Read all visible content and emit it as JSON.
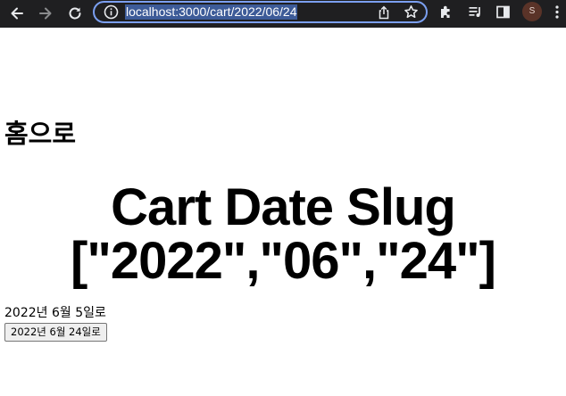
{
  "browser": {
    "url": "localhost:3000/cart/2022/06/24",
    "profile_initial": "S",
    "icons": {
      "back": "arrow-left-icon",
      "forward": "arrow-right-icon",
      "reload": "reload-icon",
      "info": "info-icon",
      "share": "share-icon",
      "bookmark": "star-icon",
      "extensions": "puzzle-icon",
      "media": "media-control-icon",
      "side_panel": "side-panel-icon",
      "menu": "kebab-menu-icon"
    }
  },
  "page": {
    "home_link": "홈으로",
    "title_line1": "Cart Date Slug",
    "title_line2": "[\"2022\",\"06\",\"24\"]",
    "date_text": "2022년 6월 5일로",
    "date_button": "2022년 6월 24일로"
  }
}
